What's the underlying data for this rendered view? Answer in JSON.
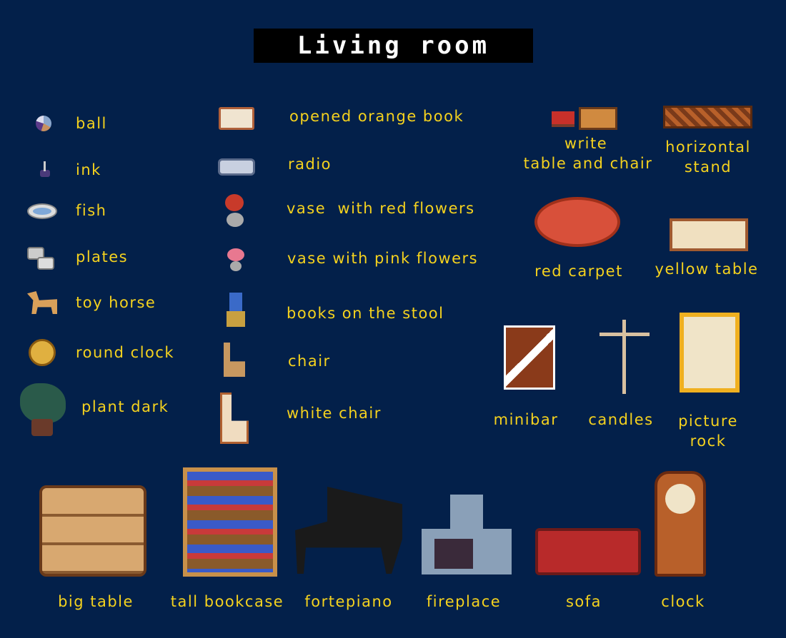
{
  "title": "Living room",
  "col1": [
    "ball",
    "ink",
    "fish",
    "plates",
    "toy horse",
    "round clock",
    "plant dark"
  ],
  "col2": [
    "opened orange book",
    "radio",
    "vase  with red flowers",
    "vase with pink flowers",
    "books on the stool",
    "chair",
    "white chair"
  ],
  "right": {
    "write_line1": "write",
    "write_line2": "table and chair",
    "stand_line1": "horizontal",
    "stand_line2": "stand",
    "red_carpet": "red carpet",
    "yellow_table": "yellow table",
    "minibar": "minibar",
    "candles": "candles",
    "picture_line1": "picture",
    "picture_line2": "rock"
  },
  "bottom": [
    "big table",
    "tall bookcase",
    "fortepiano",
    "fireplace",
    "sofa",
    "clock"
  ]
}
